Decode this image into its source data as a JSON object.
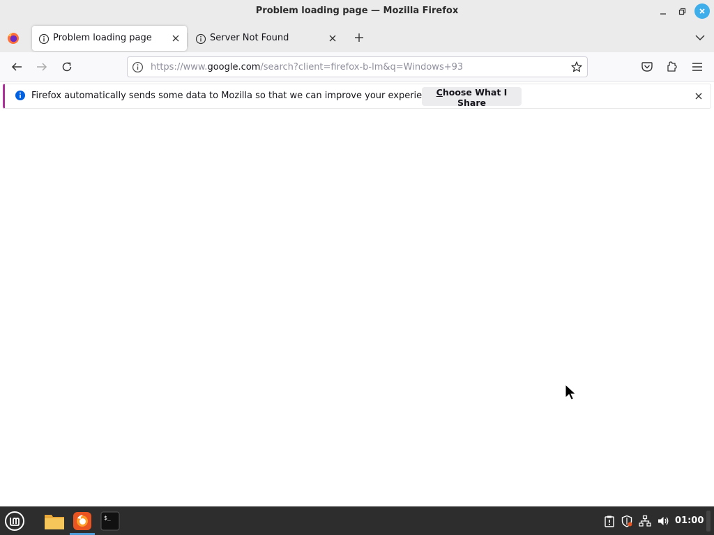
{
  "window": {
    "title": "Problem loading page — Mozilla Firefox"
  },
  "tabs": [
    {
      "label": "Problem loading page",
      "active": true,
      "icon": "info-icon"
    },
    {
      "label": "Server Not Found",
      "active": false,
      "icon": "info-icon"
    }
  ],
  "urlbar": {
    "prefix": "https://www.",
    "domain": "google.com",
    "path": "/search?client=firefox-b-lm&q=Windows+93"
  },
  "infobar": {
    "message": "Firefox automatically sends some data to Mozilla so that we can improve your experience.",
    "button_accesskey": "C",
    "button_rest": "hoose What I Share"
  },
  "taskbar": {
    "clock": "01:00",
    "apps": [
      "mint-menu-icon",
      "files-icon",
      "firefox-icon",
      "terminal-icon"
    ]
  },
  "colors": {
    "accent": "#3daee9",
    "infobar_border": "#b0319b",
    "taskbar_bg": "#2d2d2d",
    "taskbar_active": "#4c9bd6"
  }
}
